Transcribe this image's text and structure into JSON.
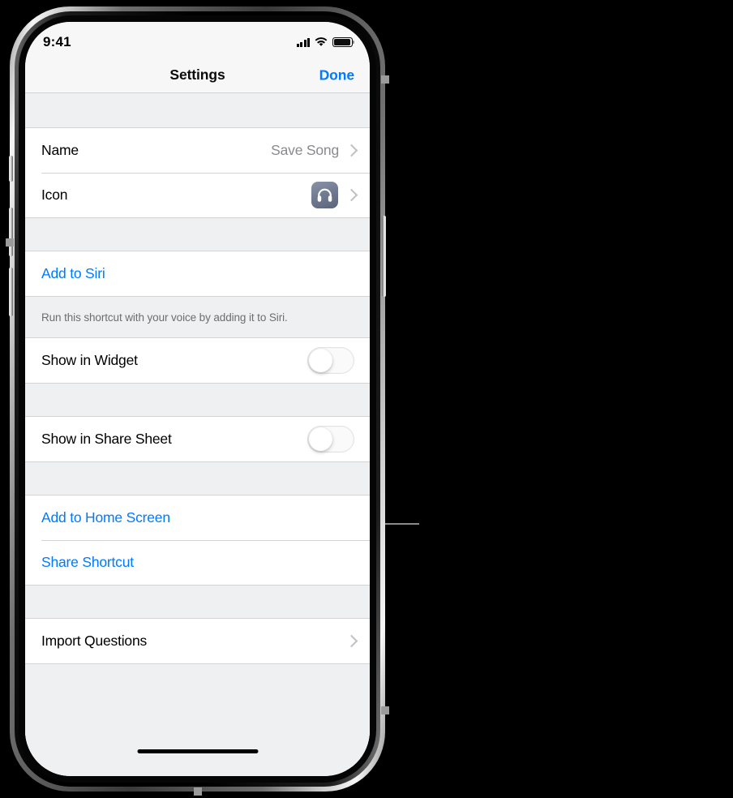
{
  "device": {
    "status_bar": {
      "time": "9:41",
      "signal_icon": "cellular-bars-icon",
      "wifi_icon": "wifi-icon",
      "battery_icon": "battery-full-icon"
    },
    "home_indicator": "home-indicator"
  },
  "navbar": {
    "title": "Settings",
    "done_label": "Done"
  },
  "sections": [
    {
      "id": "details",
      "rows": [
        {
          "label": "Name",
          "value": "Save Song",
          "accessory": "chevron-right-icon"
        },
        {
          "label": "Icon",
          "value": "",
          "accessory": "chevron-right-icon",
          "icon": "headphones-icon"
        }
      ]
    },
    {
      "id": "siri",
      "rows": [
        {
          "label": "Add to Siri",
          "style": "blue",
          "accessory": "none"
        }
      ],
      "footer": "Run this shortcut with your voice by adding it to Siri."
    },
    {
      "id": "widget",
      "rows": [
        {
          "label": "Show in Widget",
          "accessory": "toggle",
          "toggle_state": "off"
        }
      ]
    },
    {
      "id": "share-sheet",
      "rows": [
        {
          "label": "Show in Share Sheet",
          "accessory": "toggle",
          "toggle_state": "off"
        }
      ]
    },
    {
      "id": "actions",
      "rows": [
        {
          "label": "Add to Home Screen",
          "style": "blue",
          "accessory": "none"
        },
        {
          "label": "Share Shortcut",
          "style": "blue",
          "accessory": "none"
        }
      ]
    },
    {
      "id": "import",
      "rows": [
        {
          "label": "Import Questions",
          "accessory": "chevron-right-icon"
        }
      ]
    }
  ],
  "colors": {
    "tint_blue": "#007aff",
    "group_background": "#eff0f2",
    "row_background": "#ffffff",
    "separator": "#d3d3d6",
    "secondary_text": "#8a8a8e",
    "footer_text": "#6d6d72",
    "icon_slate": "#707b92"
  },
  "annotation": {
    "callout_line": "callout-leader-line"
  }
}
